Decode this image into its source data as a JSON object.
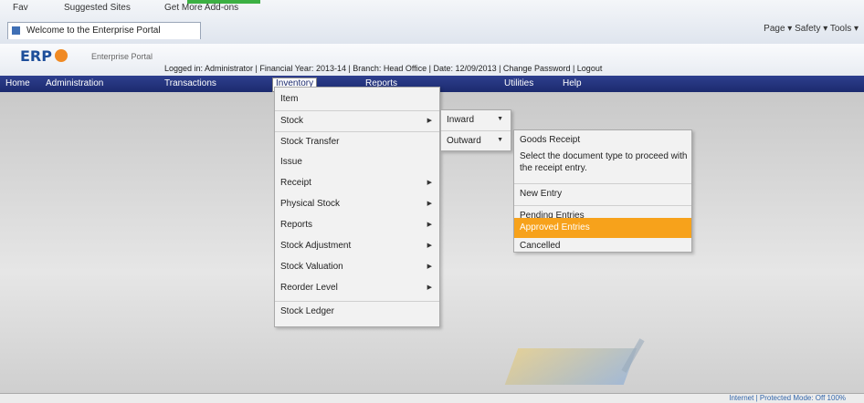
{
  "browser": {
    "favorites": [
      "Fav",
      "Suggested Sites",
      "Get More Add-ons"
    ],
    "tab_title": "Welcome to the Enterprise Portal",
    "commands": "Page ▾  Safety ▾  Tools ▾"
  },
  "app": {
    "logo": "ERP",
    "subtitle": "Enterprise Portal",
    "info_line": "Logged in: Administrator | Financial Year: 2013-14 | Branch: Head Office | Date: 12/09/2013 | Change Password | Logout"
  },
  "nav": {
    "items": [
      "Home",
      "Administration",
      "Transactions",
      "Inventory",
      "Reports",
      "Utilities",
      "Help"
    ],
    "active_index": 3
  },
  "menu1": {
    "items": [
      {
        "label": "Item",
        "arrow": false
      },
      {
        "label": "Stock",
        "arrow": true
      },
      {
        "label": "Stock Transfer",
        "arrow": false
      },
      {
        "label": "Issue",
        "arrow": false
      },
      {
        "label": "Receipt",
        "arrow": true
      },
      {
        "label": "Physical Stock",
        "arrow": true
      },
      {
        "label": "Reports",
        "arrow": true
      },
      {
        "label": "Stock Adjustment",
        "arrow": true
      },
      {
        "label": "Stock Valuation",
        "arrow": true
      },
      {
        "label": "Reorder Level",
        "arrow": true
      },
      {
        "label": "Stock Ledger",
        "arrow": false
      }
    ]
  },
  "menu2": {
    "items": [
      {
        "label": "Inward",
        "arrow": true
      },
      {
        "label": "Outward",
        "arrow": true
      }
    ]
  },
  "menu3": {
    "title": "Goods Receipt",
    "description": "Select the document type to proceed with the receipt entry.",
    "items": [
      "New Entry",
      "Pending Entries",
      "Approved Entries",
      "Cancelled"
    ],
    "highlight_index": 2
  },
  "status": {
    "text": "Internet | Protected Mode: Off  100%"
  },
  "colors": {
    "nav_bg": "#1b2a6e",
    "highlight": "#f7a21b"
  }
}
